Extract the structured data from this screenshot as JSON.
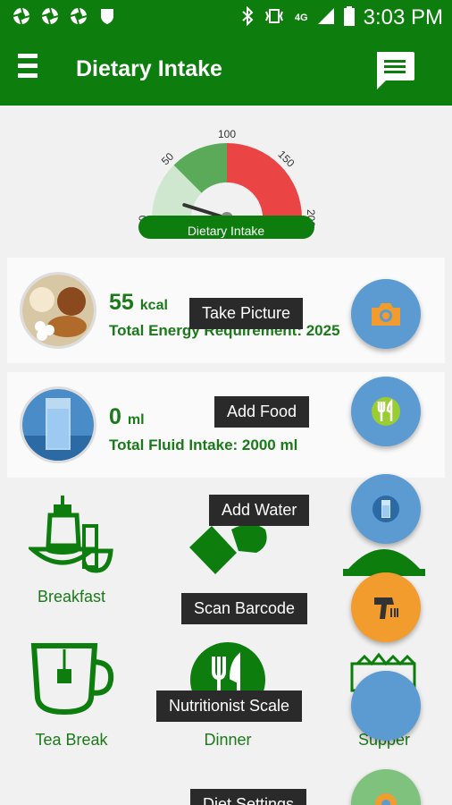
{
  "status_bar": {
    "time": "3:03 PM",
    "network": "4G",
    "icons": [
      "aperture-icon",
      "aperture-icon",
      "aperture-icon",
      "shield-icon",
      "bluetooth-icon",
      "vibrate-icon",
      "signal-icon",
      "battery-icon"
    ]
  },
  "header": {
    "title": "Dietary Intake",
    "menu_icon": "hamburger-menu-icon",
    "chat_icon": "chat-icon"
  },
  "gauge": {
    "label": "Dietary Intake",
    "ticks": [
      "0",
      "50",
      "100",
      "150",
      "200"
    ],
    "value": 55,
    "max": 200,
    "zones": [
      {
        "from": 0,
        "to": 50,
        "color": "#cfe6cf"
      },
      {
        "from": 50,
        "to": 100,
        "color": "#5aaa5a"
      },
      {
        "from": 100,
        "to": 200,
        "color": "#ea4444"
      }
    ]
  },
  "energy_card": {
    "value": "55",
    "unit": "kcal",
    "subtitle": "Total Energy Requirement: 2025"
  },
  "fluid_card": {
    "value": "0",
    "unit": "ml",
    "subtitle": "Total Fluid Intake: 2000 ml"
  },
  "meals": [
    {
      "label": "Breakfast"
    },
    {
      "label": "Tea Break"
    },
    {
      "label": "Dinner"
    },
    {
      "label": "Supper"
    }
  ],
  "fab_actions": [
    {
      "label": "Take Picture",
      "icon": "camera-icon",
      "color": "#5b9bd1"
    },
    {
      "label": "Add Food",
      "icon": "utensils-icon",
      "color": "#5b9bd1"
    },
    {
      "label": "Add Water",
      "icon": "water-glass-icon",
      "color": "#5b9bd1"
    },
    {
      "label": "Scan Barcode",
      "icon": "barcode-scanner-icon",
      "color": "#f39c2e"
    },
    {
      "label": "Nutritionist Scale",
      "icon": "scale-icon",
      "color": "#5b9bd1"
    },
    {
      "label": "Diet Settings",
      "icon": "settings-icon",
      "color": "#7ec27e"
    }
  ],
  "colors": {
    "primary": "#0d7d0d",
    "text_green": "#1a7a1a"
  }
}
